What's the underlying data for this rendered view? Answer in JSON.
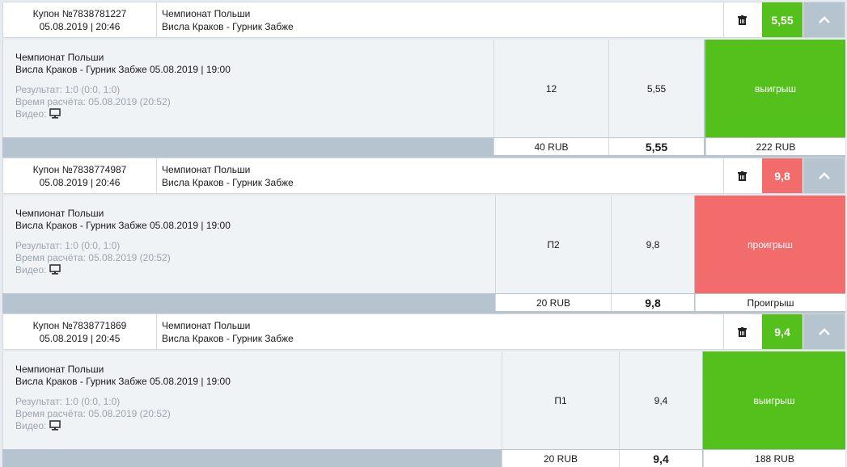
{
  "coupons": [
    {
      "number": "Купон №7838781227",
      "datetime": "05.08.2019 | 20:46",
      "league": "Чемпионат Польши",
      "match": "Висла Краков - Гурник Забже",
      "coef": "5,55",
      "status": "win",
      "detail": {
        "league": "Чемпионат Польши",
        "event": "Висла Краков - Гурник Забже 05.08.2019 | 19:00",
        "result": "Результат: 1:0 (0:0, 1:0)",
        "settled": "Время расчёта: 05.08.2019 (20:52)",
        "video": "Видео:",
        "bet": "12",
        "odds": "5,55",
        "outcome": "выигрыш",
        "stake": "40 RUB",
        "total_odds": "5,55",
        "payout": "222 RUB"
      }
    },
    {
      "number": "Купон №7838774987",
      "datetime": "05.08.2019 | 20:46",
      "league": "Чемпионат Польши",
      "match": "Висла Краков - Гурник Забже",
      "coef": "9,8",
      "status": "lose",
      "detail": {
        "league": "Чемпионат Польши",
        "event": "Висла Краков - Гурник Забже 05.08.2019 | 19:00",
        "result": "Результат: 1:0 (0:0, 1:0)",
        "settled": "Время расчёта: 05.08.2019 (20:52)",
        "video": "Видео:",
        "bet": "П2",
        "odds": "9,8",
        "outcome": "проигрыш",
        "stake": "20 RUB",
        "total_odds": "9,8",
        "payout": "Проигрыш"
      }
    },
    {
      "number": "Купон №7838771869",
      "datetime": "05.08.2019 | 20:45",
      "league": "Чемпионат Польши",
      "match": "Висла Краков - Гурник Забже",
      "coef": "9,4",
      "status": "win",
      "detail": {
        "league": "Чемпионат Польши",
        "event": "Висла Краков - Гурник Забже 05.08.2019 | 19:00",
        "result": "Результат: 1:0 (0:0, 1:0)",
        "settled": "Время расчёта: 05.08.2019 (20:52)",
        "video": "Видео:",
        "bet": "П1",
        "odds": "9,4",
        "outcome": "выигрыш",
        "stake": "20 RUB",
        "total_odds": "9,4",
        "payout": "188 RUB"
      }
    }
  ],
  "colors": {
    "win": "#54c01c",
    "lose": "#f36c6c",
    "toggle": "#b6c4d0"
  },
  "icons": {
    "delete": "trash-icon",
    "collapse": "chevron-up-icon",
    "video": "monitor-icon"
  }
}
